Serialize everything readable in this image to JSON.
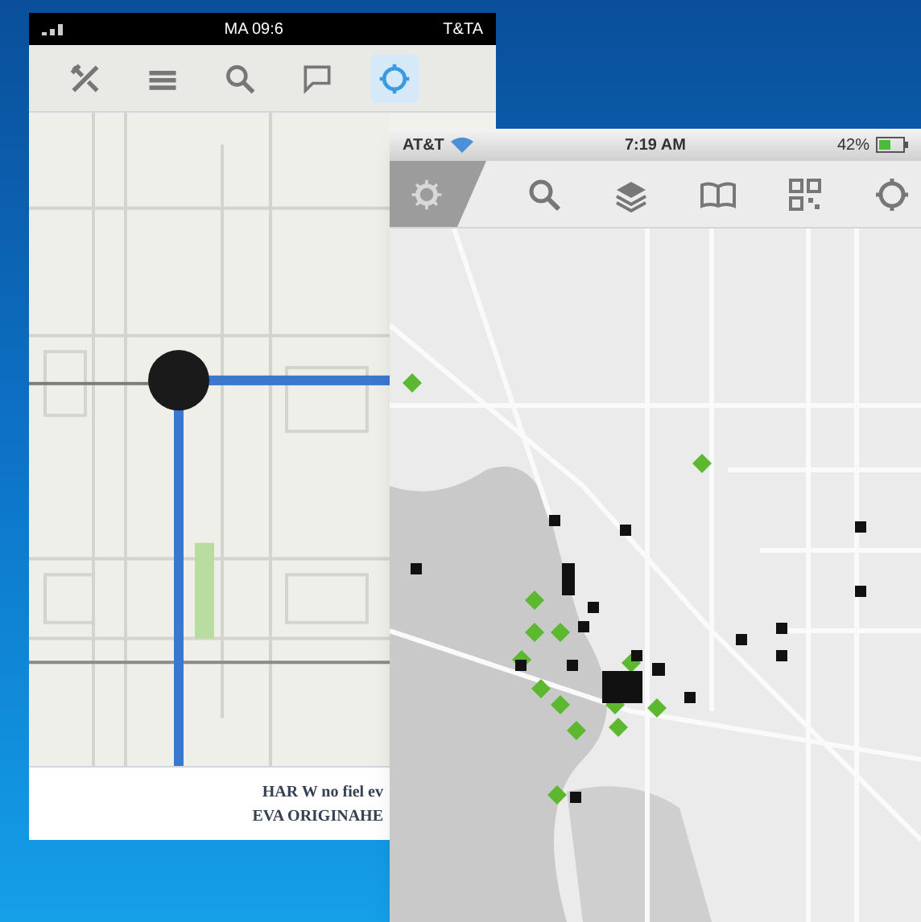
{
  "back_phone": {
    "status_bar": {
      "time": "MA 09:6",
      "carrier": "T&TA"
    },
    "toolbar": [
      {
        "kind": "tools",
        "selected": false
      },
      {
        "kind": "list",
        "selected": false
      },
      {
        "kind": "search",
        "selected": false
      },
      {
        "kind": "comment",
        "selected": false
      },
      {
        "kind": "locate",
        "selected": true
      }
    ],
    "footer": {
      "line_1": "HAR W no fiel ev",
      "line_2": "EVA ORIGINAHE"
    }
  },
  "front_phone": {
    "status_bar": {
      "carrier": "AT&T",
      "time": "7:19 AM",
      "battery": "42%"
    },
    "toolbar": [
      {
        "kind": "search"
      },
      {
        "kind": "layers"
      },
      {
        "kind": "book"
      },
      {
        "kind": "qr"
      },
      {
        "kind": "locate"
      }
    ]
  }
}
